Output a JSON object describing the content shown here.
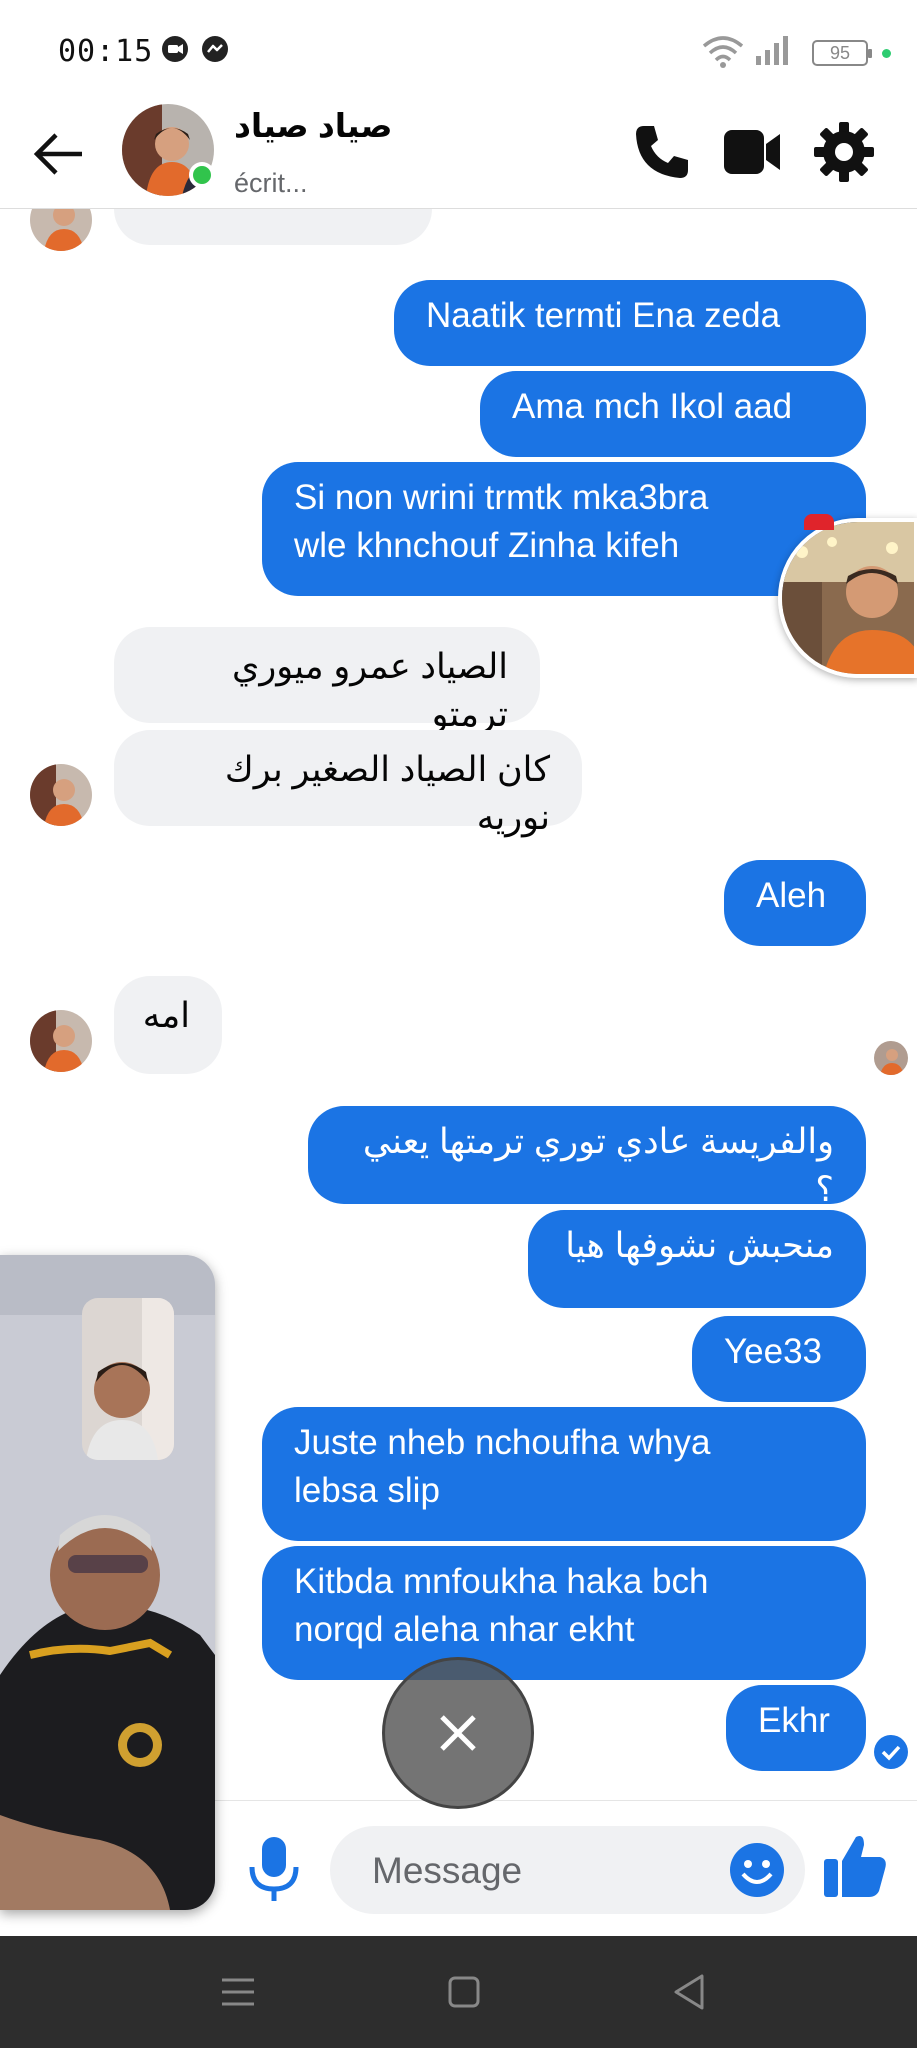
{
  "status_bar": {
    "time": "00:15",
    "battery": "95"
  },
  "header": {
    "contact_name": "صياد صياد",
    "status": "écrit..."
  },
  "messages": [
    {
      "dir": "out",
      "text": "Naatik termti Ena zeda"
    },
    {
      "dir": "out",
      "text": "Ama mch Ikol aad"
    },
    {
      "dir": "out",
      "text": "Si non wrini trmtk mka3bra\nwle khnchouf Zinha kifeh"
    },
    {
      "dir": "in",
      "text": "الصياد عمرو ميوري ترمتو"
    },
    {
      "dir": "in",
      "text": "كان الصياد الصغير برك نوريه"
    },
    {
      "dir": "out",
      "text": "Aleh"
    },
    {
      "dir": "in",
      "text": "امه"
    },
    {
      "dir": "out",
      "text": "والفريسة عادي توري ترمتها يعني ؟"
    },
    {
      "dir": "out",
      "text": "منحبش نشوفها هيا"
    },
    {
      "dir": "out",
      "text": "Yee33"
    },
    {
      "dir": "out",
      "text": "Juste nheb nchoufha whya\nlebsa slip"
    },
    {
      "dir": "out",
      "text": "Kitbda mnfoukha haka bch\nnorqd aleha nhar ekht"
    },
    {
      "dir": "out",
      "text": "Ekhr"
    }
  ],
  "composer": {
    "placeholder": "Message"
  },
  "icons": {
    "back": "back-arrow-icon",
    "call": "phone-icon",
    "video": "video-camera-icon",
    "settings": "gear-icon",
    "mic": "microphone-icon",
    "emoji": "emoji-icon",
    "like": "thumbs-up-icon",
    "close": "close-icon"
  },
  "colors": {
    "accent": "#1b74e4",
    "incoming_bubble": "#f0f1f3",
    "online": "#31c44c",
    "nav_bar": "#2d2d2d"
  }
}
